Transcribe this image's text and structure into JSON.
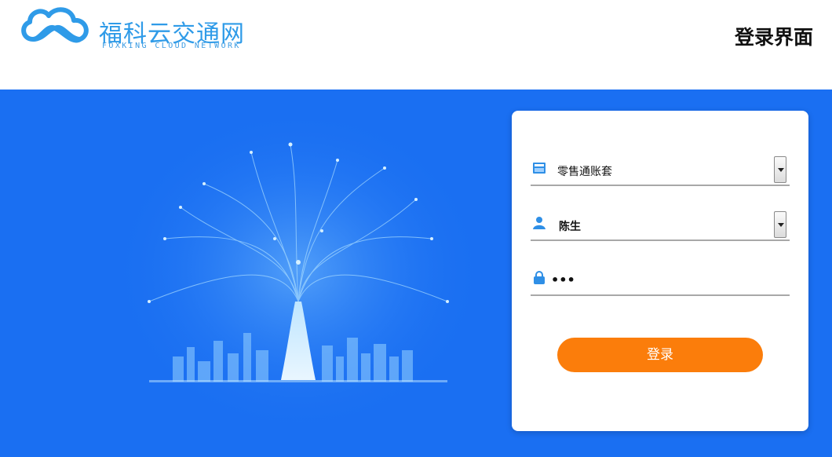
{
  "header": {
    "logo_cn": "福科云交通网",
    "logo_en": "FOXKING CLOUD NETWORK",
    "page_title": "登录界面"
  },
  "login": {
    "account_set": {
      "value": "零售通账套",
      "icon": "store-icon"
    },
    "username": {
      "value": "陈生",
      "icon": "user-icon"
    },
    "password": {
      "value": "•••",
      "icon": "lock-icon"
    },
    "submit_label": "登录"
  },
  "colors": {
    "brand_blue": "#2f9be8",
    "banner_blue": "#1a6ff2",
    "button_orange": "#fb7d0b"
  }
}
